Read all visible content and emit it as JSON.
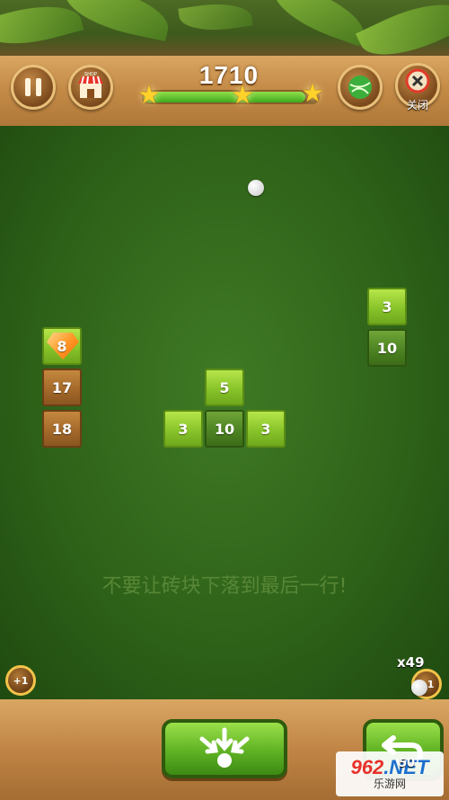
{
  "header": {
    "score": "1710",
    "progress": 0.93,
    "stars_earned": 3,
    "close_label": "关闭",
    "shop_label": "SHOP"
  },
  "board": {
    "bricks": [
      {
        "label": "8",
        "style": "lime",
        "gem": true
      },
      {
        "label": "17",
        "style": "wood"
      },
      {
        "label": "18",
        "style": "wood"
      },
      {
        "label": "5",
        "style": "lime"
      },
      {
        "label": "3",
        "style": "lime"
      },
      {
        "label": "10",
        "style": "dark"
      },
      {
        "label": "3",
        "style": "lime"
      },
      {
        "label": "3",
        "style": "lime"
      },
      {
        "label": "10",
        "style": "dark"
      }
    ],
    "hint": "不要让砖块下落到最后一行!"
  },
  "powerups": {
    "left_plus": "+1",
    "right_plus": "+1",
    "ball_count": "x49"
  },
  "footer": {
    "undo_cost": "50"
  },
  "watermark": {
    "top_red": "962",
    "top_blue": ".NET",
    "bottom": "乐游网"
  },
  "colors": {
    "board": "#2f6319",
    "wood": "#c58c48",
    "brick_lime": "#88c42a",
    "brick_dark": "#4e8423",
    "brick_wood": "#a56a2a",
    "star": "#ffd12b"
  }
}
